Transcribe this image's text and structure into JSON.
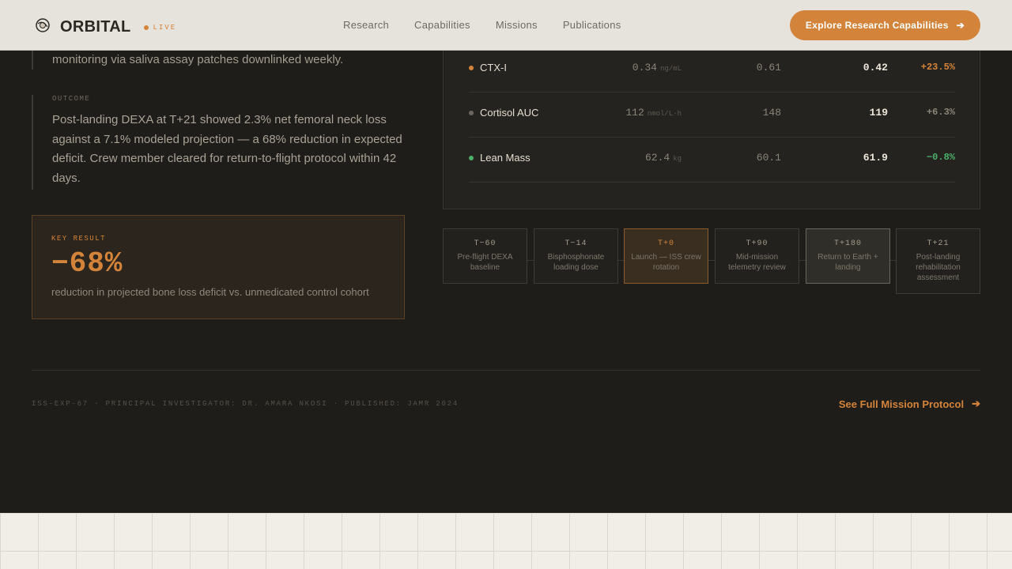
{
  "header": {
    "brand": "ORBITAL",
    "live_label": "LIVE",
    "nav": [
      "Research",
      "Capabilities",
      "Missions",
      "Publications"
    ],
    "cta_label": "Explore Research Capabilities",
    "cta_icon": "arrow-right-icon",
    "logo_icon": "orbit-logo-icon"
  },
  "left": {
    "monitoring_text": "monitoring via saliva assay patches downlinked weekly.",
    "outcome_label": "OUTCOME",
    "outcome_text": "Post-landing DEXA at T+21 showed 2.3% net femoral neck loss against a 7.1% modeled projection — a 68% reduction in expected deficit. Crew member cleared for return-to-flight protocol within 42 days.",
    "key_result": {
      "label": "KEY RESULT",
      "value": "−68%",
      "description": "reduction in projected bone loss deficit vs. unmedicated control cohort"
    }
  },
  "table": {
    "rows": [
      {
        "marker": "CTX-I",
        "dot_color": "#d4843a",
        "pre": "0.34",
        "unit": "ng/mL",
        "mid": "0.61",
        "post": "0.42",
        "delta": "+23.5%",
        "delta_color": "#d4843a"
      },
      {
        "marker": "Cortisol AUC",
        "dot_color": "#6b665e",
        "pre": "112",
        "unit": "nmol/L·h",
        "mid": "148",
        "post": "119",
        "delta": "+6.3%",
        "delta_color": "#8a8478"
      },
      {
        "marker": "Lean Mass",
        "dot_color": "#4caf6a",
        "pre": "62.4",
        "unit": "kg",
        "mid": "60.1",
        "post": "61.9",
        "delta": "−0.8%",
        "delta_color": "#4caf6a"
      }
    ]
  },
  "timeline": [
    {
      "time": "T−60",
      "label": "Pre-flight DEXA baseline",
      "state": "normal"
    },
    {
      "time": "T−14",
      "label": "Bisphosphonate loading dose",
      "state": "normal"
    },
    {
      "time": "T+0",
      "label": "Launch — ISS crew rotation",
      "state": "active"
    },
    {
      "time": "T+90",
      "label": "Mid-mission telemetry review",
      "state": "normal"
    },
    {
      "time": "T+180",
      "label": "Return to Earth + landing",
      "state": "highlight"
    },
    {
      "time": "T+21",
      "label": "Post-landing rehabilitation assessment",
      "state": "normal"
    }
  ],
  "footer": {
    "meta": "ISS-EXP-67 · PRINCIPAL INVESTIGATOR: DR. AMARA NKOSI · PUBLISHED: JAMR 2024",
    "protocol_link": "See Full Mission Protocol",
    "protocol_icon": "arrow-right-icon"
  }
}
